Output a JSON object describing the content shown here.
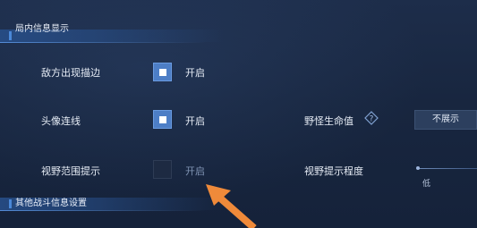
{
  "sections": {
    "top_title": "局内信息显示",
    "bottom_title": "其他战斗信息设置"
  },
  "rows": [
    {
      "label": "敌方出现描边",
      "checked": true,
      "option": "开启"
    },
    {
      "label": "头像连线",
      "checked": true,
      "option": "开启"
    },
    {
      "label": "视野范围提示",
      "checked": false,
      "option": "开启"
    }
  ],
  "right": {
    "monster_hp_label": "野怪生命值",
    "monster_hp_value": "不展示",
    "vision_hint_label": "视野提示程度",
    "vision_hint_level": "低",
    "vision_hint_fraction": 0.0
  },
  "colors": {
    "accent": "#4d7ec6",
    "arrow": "#ef8a3a"
  },
  "icons": {
    "help": "help-diamond-icon",
    "check": "checkbox-tick-icon",
    "arrow": "pointer-arrow"
  }
}
